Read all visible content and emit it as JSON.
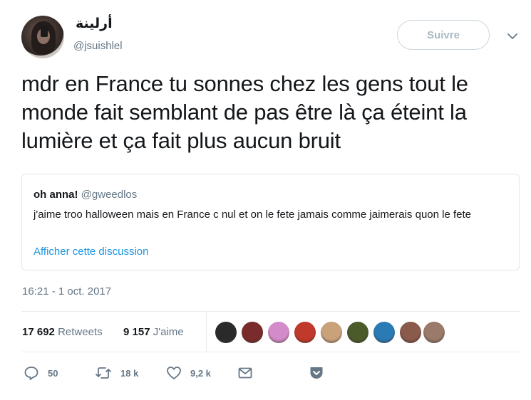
{
  "author": {
    "display_name": "أرلينة",
    "handle": "@jsuishlel"
  },
  "follow_label": "Suivre",
  "tweet_text": "mdr en France tu sonnes chez les gens tout le monde fait semblant de pas être là ça éteint la lumière et ça fait plus aucun bruit",
  "quoted": {
    "name": "oh anna!",
    "handle": "@gweedlos",
    "text": "j'aime troo halloween mais en France c nul et on le fete jamais comme jaimerais quon le fete",
    "link": "Afficher cette discussion"
  },
  "timestamp": "16:21 - 1 oct. 2017",
  "stats": {
    "retweets_count": "17 692",
    "retweets_label": "Retweets",
    "likes_count": "9 157",
    "likes_label": "J'aime"
  },
  "liker_avatars": [
    {
      "color": "#2a2a2a"
    },
    {
      "color": "#7a2b2b"
    },
    {
      "color": "#d48bc9"
    },
    {
      "color": "#c0392b"
    },
    {
      "color": "#c9a27a"
    },
    {
      "color": "#4b5b2a"
    },
    {
      "color": "#2a7ab5"
    },
    {
      "color": "#8a5a4a"
    },
    {
      "color": "#9a7a6a"
    },
    {
      "color": "#b08070"
    }
  ],
  "actions": {
    "replies": "50",
    "retweets": "18 k",
    "likes": "9,2 k"
  },
  "icons": [
    "reply-icon",
    "retweet-icon",
    "heart-icon",
    "envelope-icon",
    "save-icon",
    "chevron-down-icon"
  ]
}
